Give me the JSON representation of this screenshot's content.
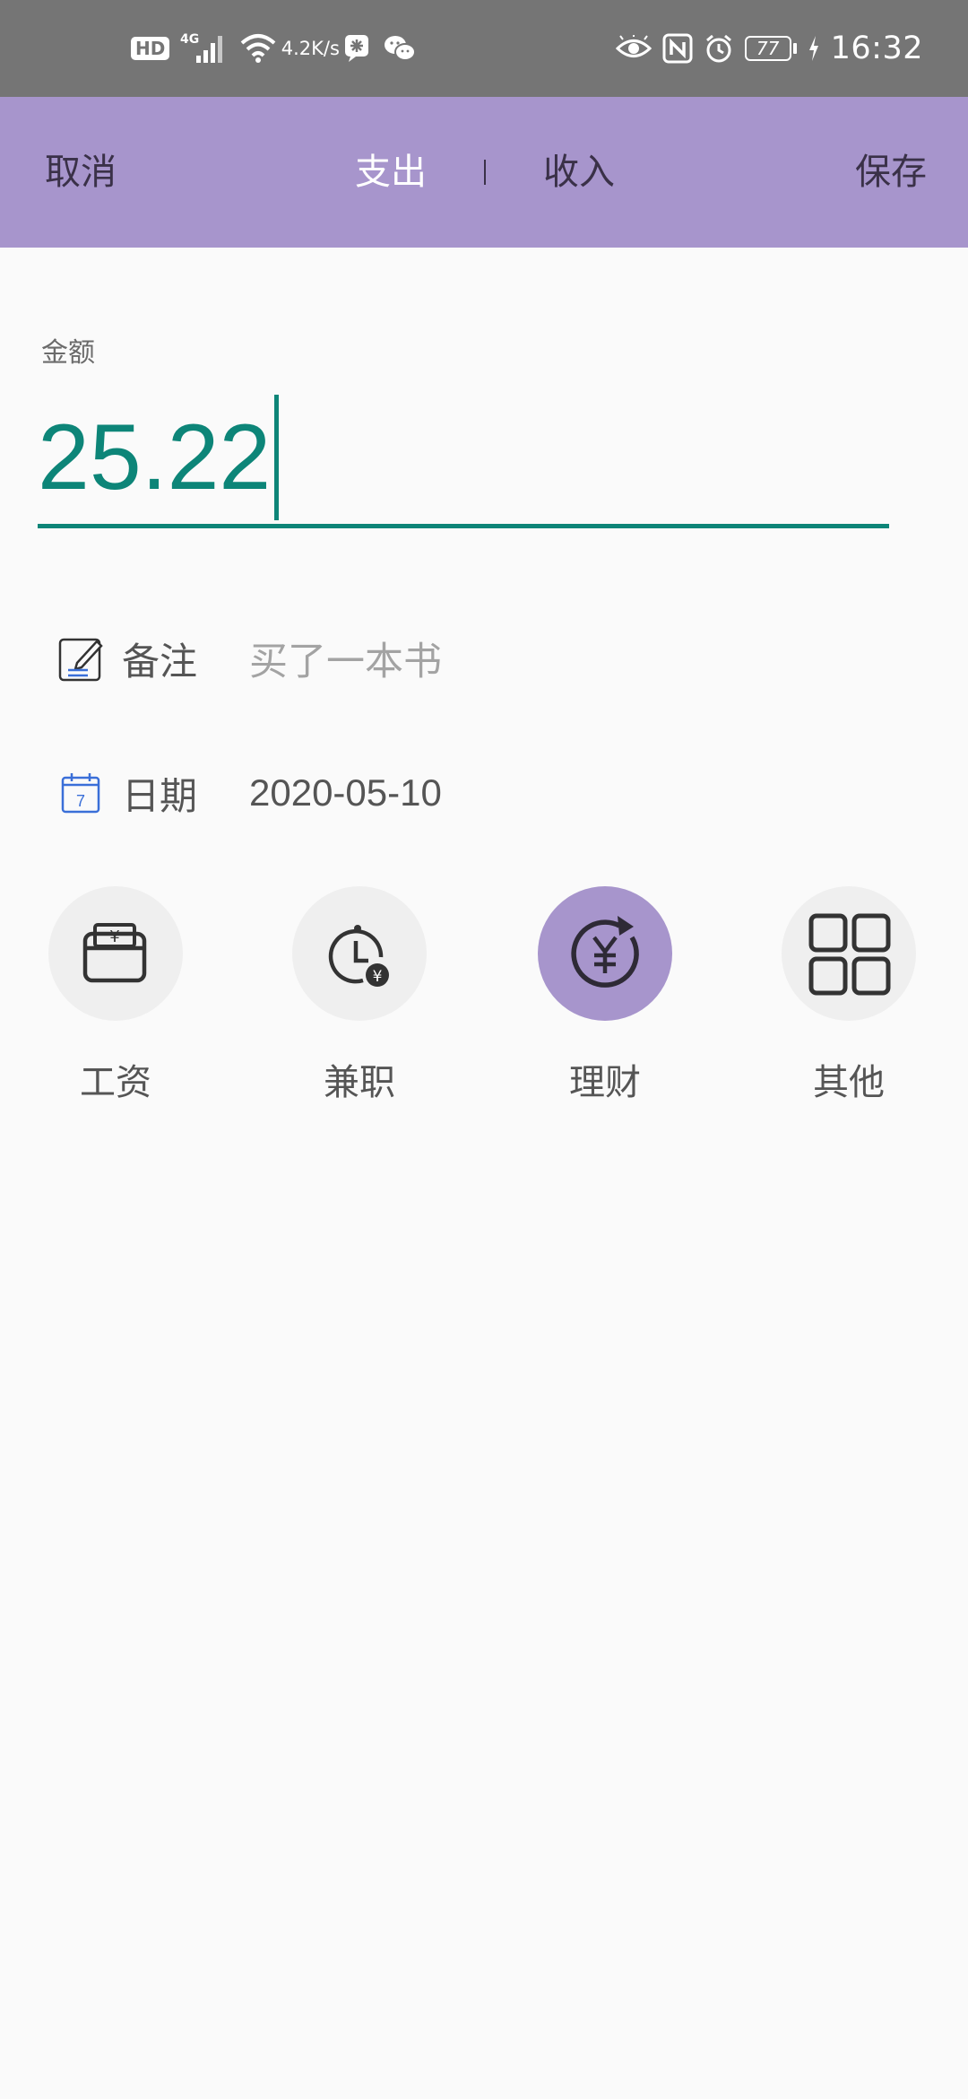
{
  "status_bar": {
    "hd_badge": "HD",
    "network_type": "4G",
    "net_speed_value": "4.2",
    "net_speed_unit": "K/s",
    "battery_level": "77",
    "time": "16:32"
  },
  "header": {
    "cancel_label": "取消",
    "tab_expense_label": "支出",
    "tab_income_label": "收入",
    "save_label": "保存",
    "active_tab": "收入",
    "background_color": "#a795cc"
  },
  "amount": {
    "label": "金额",
    "value": "25.22",
    "accent_color": "#0d8578"
  },
  "note": {
    "icon": "edit-note-icon",
    "label": "备注",
    "value": "买了一本书"
  },
  "date": {
    "icon": "calendar-icon",
    "calendar_icon_day": "7",
    "label": "日期",
    "value": "2020-05-10"
  },
  "categories": [
    {
      "label": "工资",
      "icon": "wallet-yuan-icon",
      "selected": false
    },
    {
      "label": "兼职",
      "icon": "stopwatch-yuan-icon",
      "selected": false
    },
    {
      "label": "理财",
      "icon": "yuan-cycle-icon",
      "selected": true
    },
    {
      "label": "其他",
      "icon": "grid-icon",
      "selected": false
    }
  ]
}
